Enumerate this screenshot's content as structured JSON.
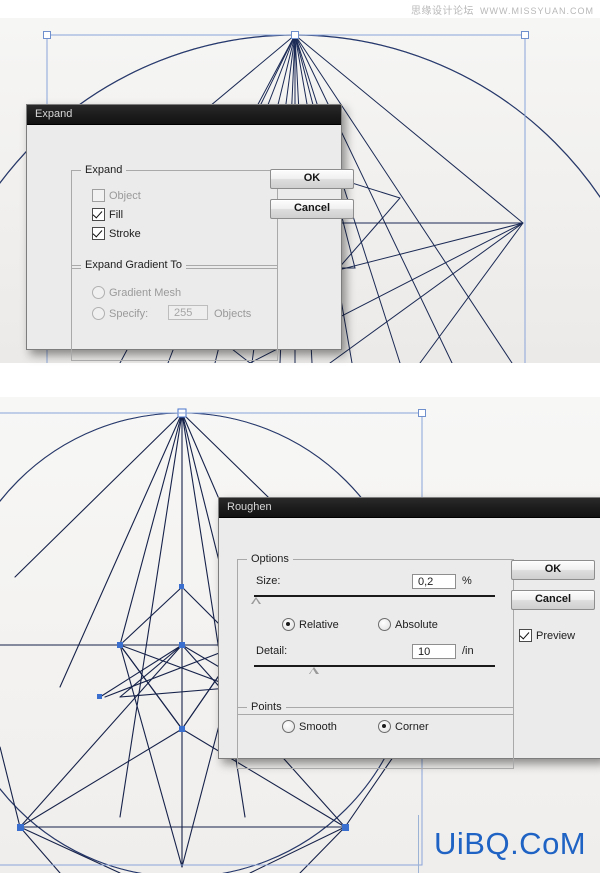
{
  "watermark": {
    "cn": "思缘设计论坛",
    "url": "WWW.MISSYUAN.COM"
  },
  "footer_logo": {
    "text": "UiBQ.CoM",
    "color": "#1f63c4"
  },
  "canvas": {
    "background": "#f4f4f2",
    "artwork_stroke": "#1b2a55",
    "selection_color": "#7d9ad6",
    "anchor_color": "#3a6ecf",
    "top_panel_label": "illustrator-artwork-circular-star-expanded",
    "bottom_panel_label": "illustrator-artwork-circular-star-roughened"
  },
  "expand_dialog": {
    "title": "Expand",
    "groups": [
      {
        "legend": "Expand",
        "checkboxes": [
          {
            "label": "Object",
            "checked": false,
            "disabled": true
          },
          {
            "label": "Fill",
            "checked": true,
            "disabled": false
          },
          {
            "label": "Stroke",
            "checked": true,
            "disabled": false
          }
        ]
      },
      {
        "legend": "Expand Gradient To",
        "radios": [
          {
            "label": "Gradient Mesh",
            "selected": false,
            "disabled": true
          },
          {
            "label": "Specify:",
            "selected": false,
            "disabled": true
          }
        ],
        "specify_value": "255",
        "specify_unit": "Objects"
      }
    ],
    "buttons": {
      "ok": "OK",
      "cancel": "Cancel"
    }
  },
  "roughen_dialog": {
    "title": "Roughen",
    "options_legend": "Options",
    "points_legend": "Points",
    "size": {
      "label": "Size:",
      "value": "0,2",
      "unit": "%",
      "slider_percent": 1
    },
    "detail": {
      "label": "Detail:",
      "value": "10",
      "unit": "/in",
      "slider_percent": 25
    },
    "size_mode_radios": [
      {
        "label": "Relative",
        "selected": true
      },
      {
        "label": "Absolute",
        "selected": false
      }
    ],
    "points_radios": [
      {
        "label": "Smooth",
        "selected": false
      },
      {
        "label": "Corner",
        "selected": true
      }
    ],
    "buttons": {
      "ok": "OK",
      "cancel": "Cancel"
    },
    "preview": {
      "label": "Preview",
      "checked": true
    }
  }
}
